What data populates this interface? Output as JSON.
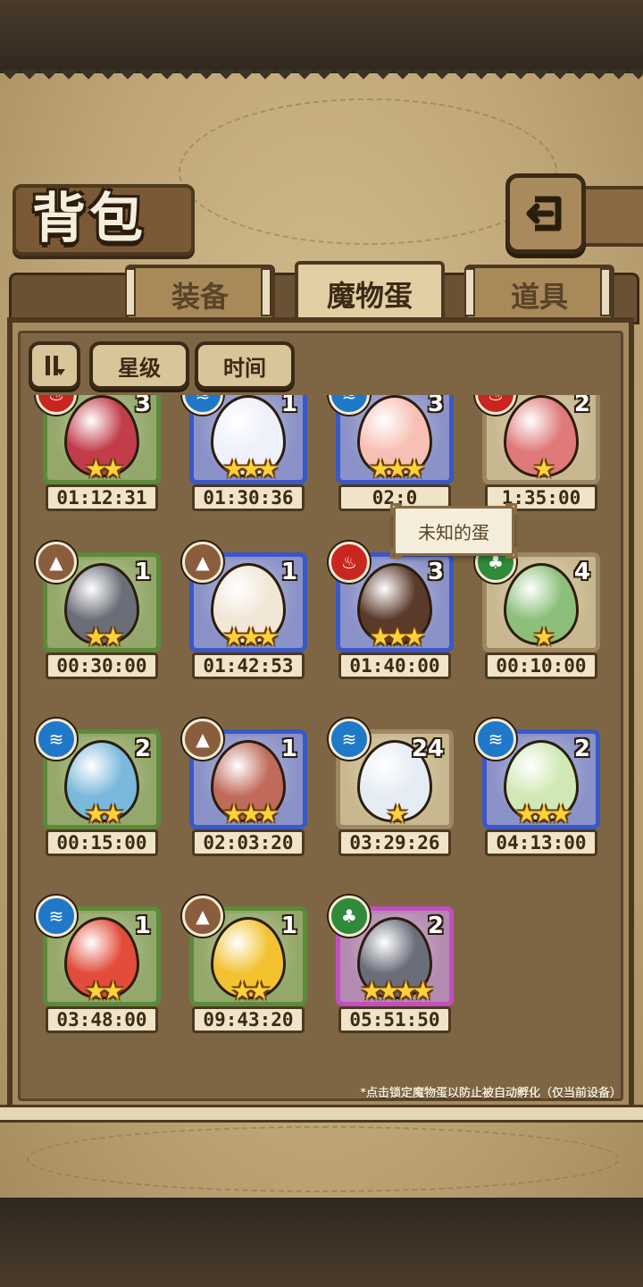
{
  "header": {
    "title": "背包",
    "back_icon": "return-arrow-icon"
  },
  "tabs": [
    {
      "label": "装备",
      "active": false
    },
    {
      "label": "魔物蛋",
      "active": true
    },
    {
      "label": "道具",
      "active": false
    }
  ],
  "sort_bar": {
    "toggle_icon": "pause-sort-icon",
    "buttons": [
      "星级",
      "时间"
    ]
  },
  "tooltip": {
    "text": "未知的蛋"
  },
  "eggs": [
    {
      "count": "3",
      "stars": "★★",
      "timer": "01:12:31",
      "frame": "green",
      "element": "fire",
      "color": "#c23c4a"
    },
    {
      "count": "1",
      "stars": "★★★",
      "timer": "01:30:36",
      "frame": "blue",
      "element": "water",
      "color": "#eef0fa"
    },
    {
      "count": "3",
      "stars": "★★★",
      "timer": "02:0",
      "frame": "blue",
      "element": "water",
      "color": "#f7c0b4"
    },
    {
      "count": "2",
      "stars": "★",
      "timer": "1:35:00",
      "frame": "tan",
      "element": "fire",
      "color": "#e07a7a"
    },
    {
      "count": "1",
      "stars": "★★",
      "timer": "00:30:00",
      "frame": "green",
      "element": "earth",
      "color": "#6a6e78"
    },
    {
      "count": "1",
      "stars": "★★★",
      "timer": "01:42:53",
      "frame": "blue",
      "element": "earth",
      "color": "#f2e6d6"
    },
    {
      "count": "3",
      "stars": "★★★",
      "timer": "01:40:00",
      "frame": "blue",
      "element": "fire",
      "color": "#5a3a2a"
    },
    {
      "count": "4",
      "stars": "★",
      "timer": "00:10:00",
      "frame": "tan",
      "element": "wood",
      "color": "#8cc07a"
    },
    {
      "count": "2",
      "stars": "★★",
      "timer": "00:15:00",
      "frame": "green",
      "element": "water",
      "color": "#7ab8dc"
    },
    {
      "count": "1",
      "stars": "★★★",
      "timer": "02:03:20",
      "frame": "blue",
      "element": "earth",
      "color": "#c06a5a"
    },
    {
      "count": "24",
      "stars": "★",
      "timer": "03:29:26",
      "frame": "tan",
      "element": "water",
      "color": "#e6ecf4"
    },
    {
      "count": "2",
      "stars": "★★★",
      "timer": "04:13:00",
      "frame": "blue",
      "element": "water",
      "color": "#cfe8b4"
    },
    {
      "count": "1",
      "stars": "★★",
      "timer": "03:48:00",
      "frame": "green",
      "element": "water",
      "color": "#e24c3a"
    },
    {
      "count": "1",
      "stars": "★★",
      "timer": "09:43:20",
      "frame": "green",
      "element": "earth",
      "color": "#f2c230"
    },
    {
      "count": "2",
      "stars": "★★★★",
      "timer": "05:51:50",
      "frame": "pink",
      "element": "wood",
      "color": "#6a6e7a"
    }
  ],
  "footer_hint": "*点击锁定魔物蛋以防止被自动孵化（仅当前设备）",
  "colors": {
    "parchment": "#c9b386",
    "panel": "#7e6645",
    "star": "#ffd23a"
  }
}
